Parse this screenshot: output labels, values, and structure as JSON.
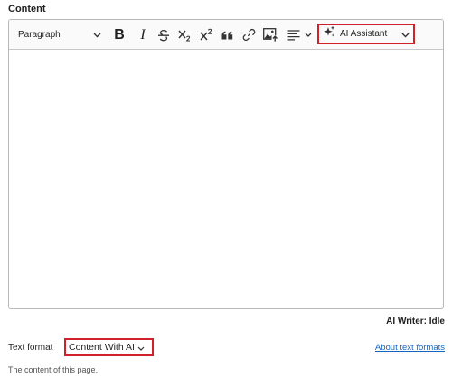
{
  "field": {
    "label": "Content"
  },
  "toolbar": {
    "paragraph_select": "Paragraph",
    "bold_glyph": "B",
    "italic_glyph": "I",
    "ai_assistant_label": "AI Assistant",
    "icons": [
      "chevron-down-icon",
      "bold-icon",
      "italic-icon",
      "strikethrough-icon",
      "subscript-icon",
      "superscript-icon",
      "blockquote-icon",
      "link-icon",
      "insert-image-icon",
      "align-left-icon",
      "sparkle-icon"
    ]
  },
  "status": {
    "text": "AI Writer: Idle"
  },
  "text_format": {
    "label": "Text format",
    "selected": "Content With AI",
    "about_link": "About text formats"
  },
  "description": "The content of this page.",
  "colors": {
    "highlight": "#d0202a",
    "link": "#1565c0",
    "border": "#b8b8b8"
  }
}
